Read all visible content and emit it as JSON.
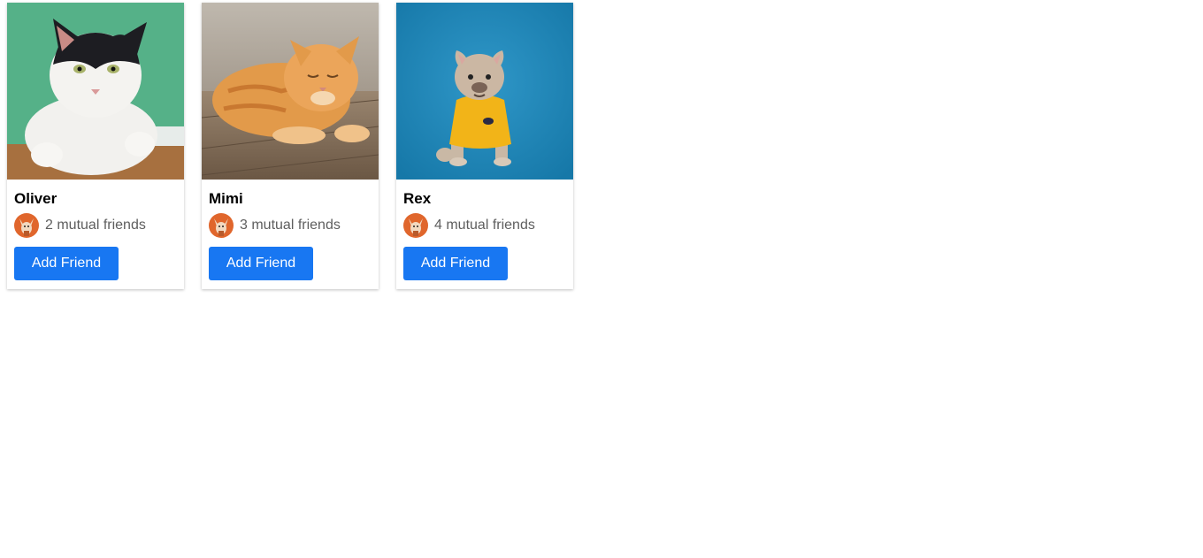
{
  "colors": {
    "button_bg": "#1877f2",
    "button_text": "#ffffff",
    "mutual_text": "#5e5e5e",
    "avatar_bg": "#e0662c"
  },
  "cards": [
    {
      "name": "Oliver",
      "photo": "black-and-white-cat-photo",
      "mutual": "2 mutual friends",
      "button": "Add Friend"
    },
    {
      "name": "Mimi",
      "photo": "orange-tabby-cat-photo",
      "mutual": "3 mutual friends",
      "button": "Add Friend"
    },
    {
      "name": "Rex",
      "photo": "french-bulldog-in-yellow-shirt-photo",
      "mutual": "4 mutual friends",
      "button": "Add Friend"
    }
  ]
}
